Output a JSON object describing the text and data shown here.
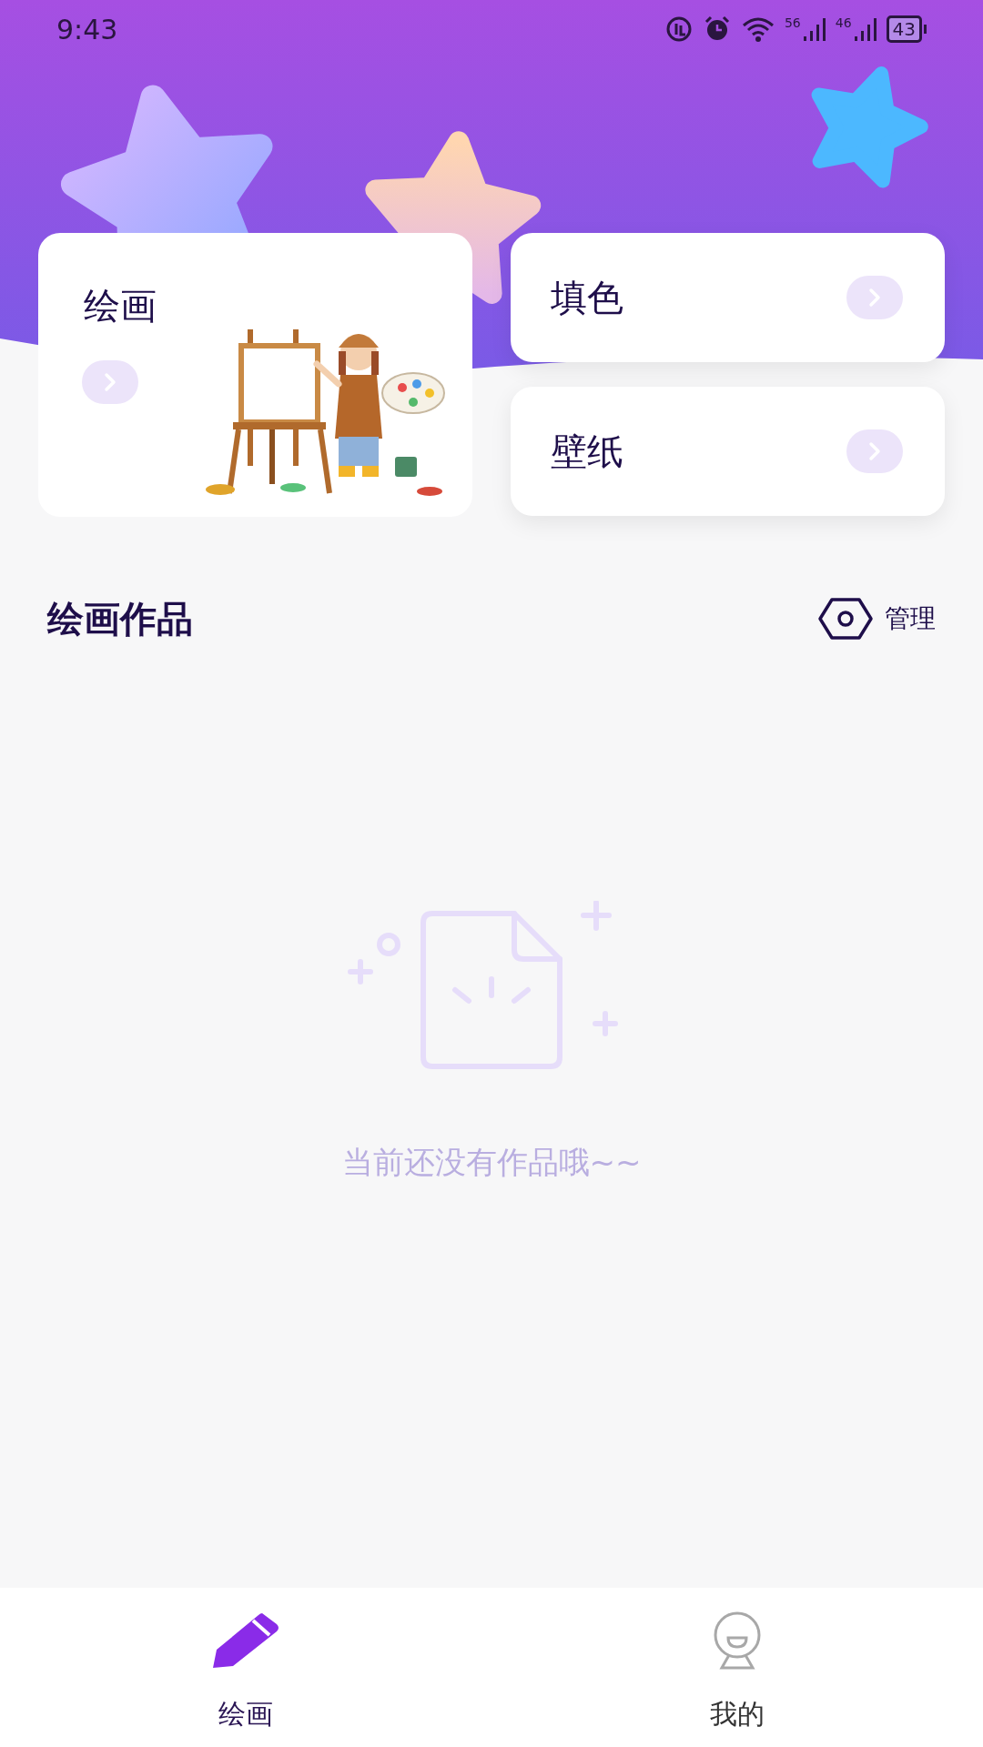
{
  "status_bar": {
    "time": "9:43",
    "signals": [
      {
        "label": "56"
      },
      {
        "label": "46"
      }
    ],
    "battery": "43"
  },
  "cards": [
    {
      "kind": "large",
      "title": "绘画"
    },
    {
      "kind": "small",
      "title": "填色"
    },
    {
      "kind": "small",
      "title": "壁纸"
    }
  ],
  "section": {
    "title": "绘画作品",
    "action": "管理"
  },
  "empty_state": {
    "message": "当前还没有作品哦~~"
  },
  "bottom_nav": [
    {
      "label": "绘画",
      "selected": true
    },
    {
      "label": "我的",
      "selected": false
    }
  ]
}
